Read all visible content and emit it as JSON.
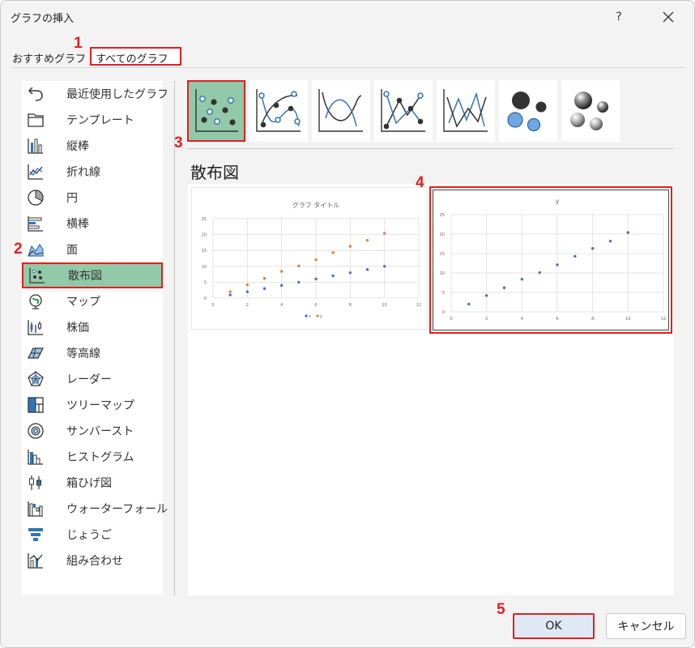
{
  "window": {
    "title": "グラフの挿入",
    "help": "?",
    "close": "✕"
  },
  "tabs": {
    "recommended": "おすすめグラフ",
    "all": "すべてのグラフ"
  },
  "sidebar": {
    "items": [
      {
        "label": "最近使用したグラフ",
        "icon": "undo-icon"
      },
      {
        "label": "テンプレート",
        "icon": "folder-icon"
      },
      {
        "label": "縦棒",
        "icon": "column-chart-icon"
      },
      {
        "label": "折れ線",
        "icon": "line-chart-icon"
      },
      {
        "label": "円",
        "icon": "pie-chart-icon"
      },
      {
        "label": "横棒",
        "icon": "bar-chart-icon"
      },
      {
        "label": "面",
        "icon": "area-chart-icon"
      },
      {
        "label": "散布図",
        "icon": "scatter-chart-icon"
      },
      {
        "label": "マップ",
        "icon": "map-globe-icon"
      },
      {
        "label": "株価",
        "icon": "stock-chart-icon"
      },
      {
        "label": "等高線",
        "icon": "surface-chart-icon"
      },
      {
        "label": "レーダー",
        "icon": "radar-chart-icon"
      },
      {
        "label": "ツリーマップ",
        "icon": "treemap-icon"
      },
      {
        "label": "サンバースト",
        "icon": "sunburst-icon"
      },
      {
        "label": "ヒストグラム",
        "icon": "histogram-icon"
      },
      {
        "label": "箱ひげ図",
        "icon": "box-whisker-icon"
      },
      {
        "label": "ウォーターフォール",
        "icon": "waterfall-icon"
      },
      {
        "label": "じょうご",
        "icon": "funnel-icon"
      },
      {
        "label": "組み合わせ",
        "icon": "combo-chart-icon"
      }
    ],
    "selected": "散布図"
  },
  "chart_types": [
    "scatter",
    "scatter-smooth-markers",
    "scatter-smooth",
    "scatter-straight-markers",
    "scatter-straight",
    "bubble",
    "bubble-3d"
  ],
  "section_title": "散布図",
  "annotations": [
    "1",
    "2",
    "3",
    "4",
    "5"
  ],
  "buttons": {
    "ok": "OK",
    "cancel": "キャンセル"
  },
  "colors": {
    "accent_red": "#e02020",
    "selected_green": "#92c9a8",
    "series_blue": "#4472c4",
    "series_orange": "#ed7d31"
  },
  "chart_data": [
    {
      "type": "scatter",
      "title": "グラフ タイトル",
      "x": [
        1,
        2,
        3,
        4,
        5,
        6,
        7,
        8,
        9,
        10
      ],
      "series": [
        {
          "name": "x",
          "values": [
            1,
            2,
            3,
            4,
            5,
            6,
            7,
            8,
            9,
            10
          ]
        },
        {
          "name": "y",
          "values": [
            2,
            4.2,
            6.2,
            8.4,
            10.1,
            12.1,
            14.3,
            16.3,
            18.2,
            20.4
          ]
        }
      ],
      "xlim": [
        0,
        12
      ],
      "ylim": [
        0,
        25
      ],
      "xticks": [
        "0",
        "2",
        "4",
        "6",
        "8",
        "10",
        "12"
      ],
      "yticks": [
        "0",
        "5",
        "10",
        "15",
        "20",
        "25"
      ],
      "legend": "bottom",
      "grid": true
    },
    {
      "type": "scatter",
      "title": "y",
      "x": [
        1,
        2,
        3,
        4,
        5,
        6,
        7,
        8,
        9,
        10
      ],
      "series": [
        {
          "values": [
            2,
            4.2,
            6.2,
            8.4,
            10.1,
            12.1,
            14.3,
            16.3,
            18.2,
            20.4
          ]
        }
      ],
      "xlim": [
        0,
        12
      ],
      "ylim": [
        0,
        25
      ],
      "xticks": [
        "0",
        "2",
        "4",
        "6",
        "8",
        "10",
        "12"
      ],
      "yticks": [
        "0",
        "5",
        "10",
        "15",
        "20",
        "25"
      ],
      "legend": "none",
      "grid": true
    }
  ]
}
